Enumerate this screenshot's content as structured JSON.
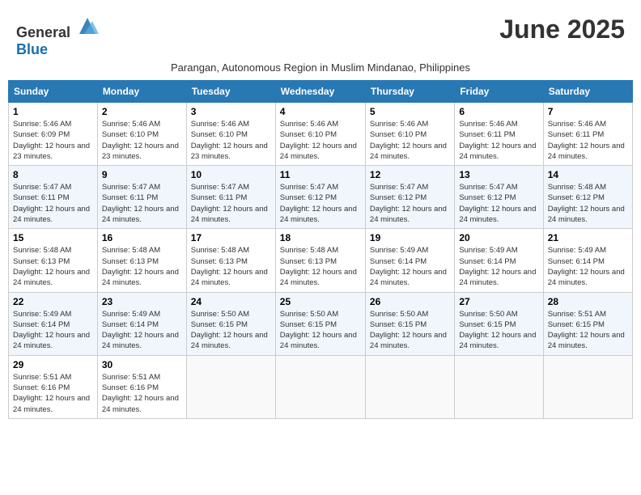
{
  "header": {
    "logo_general": "General",
    "logo_blue": "Blue",
    "month_title": "June 2025",
    "subtitle": "Parangan, Autonomous Region in Muslim Mindanao, Philippines"
  },
  "days_of_week": [
    "Sunday",
    "Monday",
    "Tuesday",
    "Wednesday",
    "Thursday",
    "Friday",
    "Saturday"
  ],
  "weeks": [
    [
      {
        "day": "1",
        "sunrise": "5:46 AM",
        "sunset": "6:09 PM",
        "daylight": "12 hours and 23 minutes."
      },
      {
        "day": "2",
        "sunrise": "5:46 AM",
        "sunset": "6:10 PM",
        "daylight": "12 hours and 23 minutes."
      },
      {
        "day": "3",
        "sunrise": "5:46 AM",
        "sunset": "6:10 PM",
        "daylight": "12 hours and 23 minutes."
      },
      {
        "day": "4",
        "sunrise": "5:46 AM",
        "sunset": "6:10 PM",
        "daylight": "12 hours and 24 minutes."
      },
      {
        "day": "5",
        "sunrise": "5:46 AM",
        "sunset": "6:10 PM",
        "daylight": "12 hours and 24 minutes."
      },
      {
        "day": "6",
        "sunrise": "5:46 AM",
        "sunset": "6:11 PM",
        "daylight": "12 hours and 24 minutes."
      },
      {
        "day": "7",
        "sunrise": "5:46 AM",
        "sunset": "6:11 PM",
        "daylight": "12 hours and 24 minutes."
      }
    ],
    [
      {
        "day": "8",
        "sunrise": "5:47 AM",
        "sunset": "6:11 PM",
        "daylight": "12 hours and 24 minutes."
      },
      {
        "day": "9",
        "sunrise": "5:47 AM",
        "sunset": "6:11 PM",
        "daylight": "12 hours and 24 minutes."
      },
      {
        "day": "10",
        "sunrise": "5:47 AM",
        "sunset": "6:11 PM",
        "daylight": "12 hours and 24 minutes."
      },
      {
        "day": "11",
        "sunrise": "5:47 AM",
        "sunset": "6:12 PM",
        "daylight": "12 hours and 24 minutes."
      },
      {
        "day": "12",
        "sunrise": "5:47 AM",
        "sunset": "6:12 PM",
        "daylight": "12 hours and 24 minutes."
      },
      {
        "day": "13",
        "sunrise": "5:47 AM",
        "sunset": "6:12 PM",
        "daylight": "12 hours and 24 minutes."
      },
      {
        "day": "14",
        "sunrise": "5:48 AM",
        "sunset": "6:12 PM",
        "daylight": "12 hours and 24 minutes."
      }
    ],
    [
      {
        "day": "15",
        "sunrise": "5:48 AM",
        "sunset": "6:13 PM",
        "daylight": "12 hours and 24 minutes."
      },
      {
        "day": "16",
        "sunrise": "5:48 AM",
        "sunset": "6:13 PM",
        "daylight": "12 hours and 24 minutes."
      },
      {
        "day": "17",
        "sunrise": "5:48 AM",
        "sunset": "6:13 PM",
        "daylight": "12 hours and 24 minutes."
      },
      {
        "day": "18",
        "sunrise": "5:48 AM",
        "sunset": "6:13 PM",
        "daylight": "12 hours and 24 minutes."
      },
      {
        "day": "19",
        "sunrise": "5:49 AM",
        "sunset": "6:14 PM",
        "daylight": "12 hours and 24 minutes."
      },
      {
        "day": "20",
        "sunrise": "5:49 AM",
        "sunset": "6:14 PM",
        "daylight": "12 hours and 24 minutes."
      },
      {
        "day": "21",
        "sunrise": "5:49 AM",
        "sunset": "6:14 PM",
        "daylight": "12 hours and 24 minutes."
      }
    ],
    [
      {
        "day": "22",
        "sunrise": "5:49 AM",
        "sunset": "6:14 PM",
        "daylight": "12 hours and 24 minutes."
      },
      {
        "day": "23",
        "sunrise": "5:49 AM",
        "sunset": "6:14 PM",
        "daylight": "12 hours and 24 minutes."
      },
      {
        "day": "24",
        "sunrise": "5:50 AM",
        "sunset": "6:15 PM",
        "daylight": "12 hours and 24 minutes."
      },
      {
        "day": "25",
        "sunrise": "5:50 AM",
        "sunset": "6:15 PM",
        "daylight": "12 hours and 24 minutes."
      },
      {
        "day": "26",
        "sunrise": "5:50 AM",
        "sunset": "6:15 PM",
        "daylight": "12 hours and 24 minutes."
      },
      {
        "day": "27",
        "sunrise": "5:50 AM",
        "sunset": "6:15 PM",
        "daylight": "12 hours and 24 minutes."
      },
      {
        "day": "28",
        "sunrise": "5:51 AM",
        "sunset": "6:15 PM",
        "daylight": "12 hours and 24 minutes."
      }
    ],
    [
      {
        "day": "29",
        "sunrise": "5:51 AM",
        "sunset": "6:16 PM",
        "daylight": "12 hours and 24 minutes."
      },
      {
        "day": "30",
        "sunrise": "5:51 AM",
        "sunset": "6:16 PM",
        "daylight": "12 hours and 24 minutes."
      },
      null,
      null,
      null,
      null,
      null
    ]
  ]
}
